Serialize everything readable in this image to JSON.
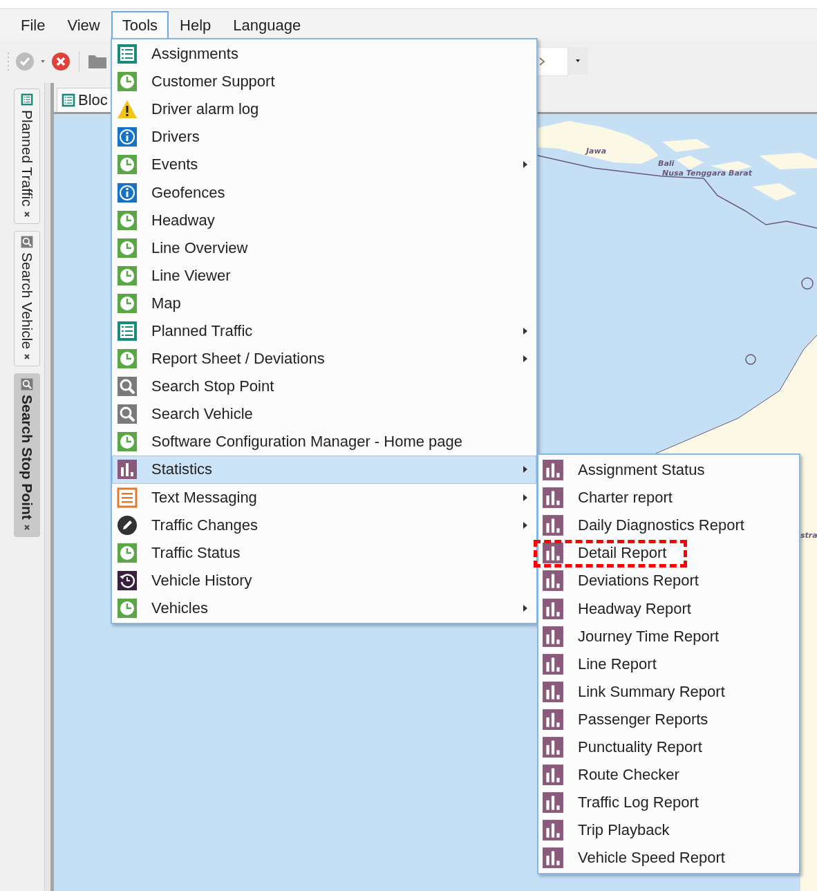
{
  "menu_bar": [
    {
      "label": "File",
      "selected": false
    },
    {
      "label": "View",
      "selected": false
    },
    {
      "label": "Tools",
      "selected": true
    },
    {
      "label": "Help",
      "selected": false
    },
    {
      "label": "Language",
      "selected": false
    }
  ],
  "side_tabs": [
    {
      "label": "Planned Traffic",
      "kind": "list",
      "selected": false
    },
    {
      "label": "Search Vehicle",
      "kind": "search",
      "selected": false
    },
    {
      "label": "Search Stop Point",
      "kind": "search",
      "selected": true
    }
  ],
  "document_tab": {
    "label": "Bloc",
    "kind": "list"
  },
  "map": {
    "labels": [
      "Jawa",
      "Bali",
      "Nusa Tenggara Barat",
      "stra"
    ]
  },
  "tools_menu": {
    "items": [
      {
        "label": "Assignments",
        "kind": "list",
        "has_submenu": false,
        "selected": false
      },
      {
        "label": "Customer Support",
        "kind": "clock",
        "has_submenu": false,
        "selected": false
      },
      {
        "label": "Driver alarm log",
        "kind": "warning",
        "has_submenu": false,
        "selected": false
      },
      {
        "label": "Drivers",
        "kind": "info",
        "has_submenu": false,
        "selected": false
      },
      {
        "label": "Events",
        "kind": "clock",
        "has_submenu": true,
        "selected": false
      },
      {
        "label": "Geofences",
        "kind": "info",
        "has_submenu": false,
        "selected": false
      },
      {
        "label": "Headway",
        "kind": "clock",
        "has_submenu": false,
        "selected": false
      },
      {
        "label": "Line Overview",
        "kind": "clock",
        "has_submenu": false,
        "selected": false
      },
      {
        "label": "Line Viewer",
        "kind": "clock",
        "has_submenu": false,
        "selected": false
      },
      {
        "label": "Map",
        "kind": "clock",
        "has_submenu": false,
        "selected": false
      },
      {
        "label": "Planned Traffic",
        "kind": "list",
        "has_submenu": true,
        "selected": false
      },
      {
        "label": "Report Sheet / Deviations",
        "kind": "clock",
        "has_submenu": true,
        "selected": false
      },
      {
        "label": "Search Stop Point",
        "kind": "search",
        "has_submenu": false,
        "selected": false
      },
      {
        "label": "Search Vehicle",
        "kind": "search",
        "has_submenu": false,
        "selected": false
      },
      {
        "label": "Software Configuration Manager - Home page",
        "kind": "clock",
        "has_submenu": false,
        "selected": false
      },
      {
        "label": "Statistics",
        "kind": "chart",
        "has_submenu": true,
        "selected": true
      },
      {
        "label": "Text Messaging",
        "kind": "text",
        "has_submenu": true,
        "selected": false
      },
      {
        "label": "Traffic Changes",
        "kind": "edit",
        "has_submenu": true,
        "selected": false
      },
      {
        "label": "Traffic Status",
        "kind": "clock",
        "has_submenu": false,
        "selected": false
      },
      {
        "label": "Vehicle History",
        "kind": "history",
        "has_submenu": false,
        "selected": false
      },
      {
        "label": "Vehicles",
        "kind": "clock",
        "has_submenu": true,
        "selected": false
      }
    ]
  },
  "statistics_menu": {
    "items": [
      {
        "label": "Assignment Status",
        "annotated": false
      },
      {
        "label": "Charter report",
        "annotated": false
      },
      {
        "label": "Daily Diagnostics Report",
        "annotated": false
      },
      {
        "label": "Detail Report",
        "annotated": true
      },
      {
        "label": "Deviations Report",
        "annotated": false
      },
      {
        "label": "Headway Report",
        "annotated": false
      },
      {
        "label": "Journey Time Report",
        "annotated": false
      },
      {
        "label": "Line Report",
        "annotated": false
      },
      {
        "label": "Link Summary Report",
        "annotated": false
      },
      {
        "label": "Passenger Reports",
        "annotated": false
      },
      {
        "label": "Punctuality Report",
        "annotated": false
      },
      {
        "label": "Route Checker",
        "annotated": false
      },
      {
        "label": "Traffic Log Report",
        "annotated": false
      },
      {
        "label": "Trip Playback",
        "annotated": false
      },
      {
        "label": "Vehicle Speed Report",
        "annotated": false
      }
    ]
  }
}
